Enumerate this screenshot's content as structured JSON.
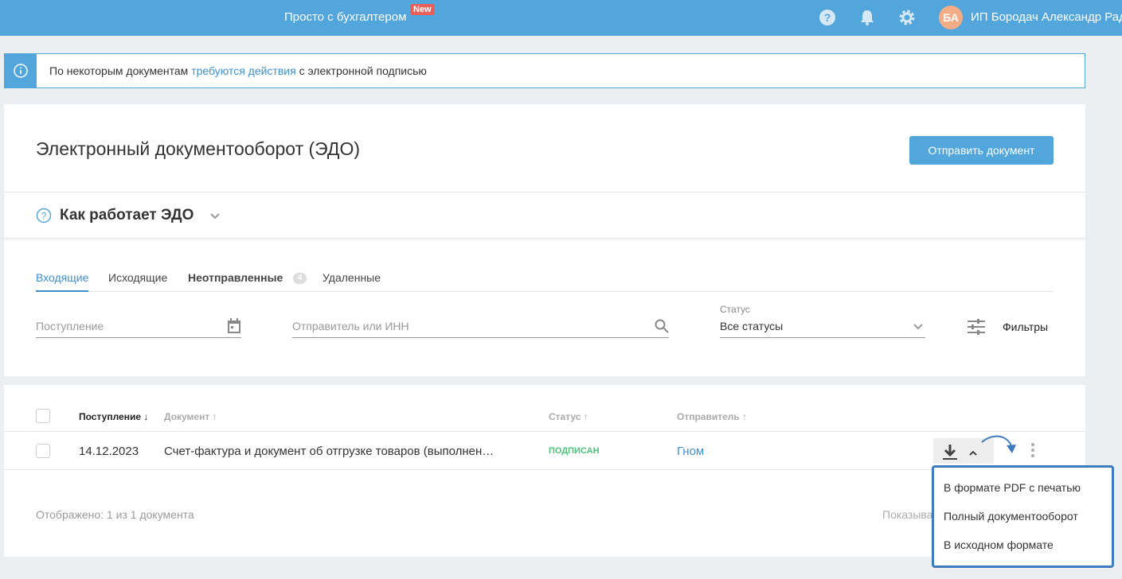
{
  "topbar": {
    "brand": "Просто с бухгалтером",
    "new_badge": "New",
    "avatar_initials": "БА",
    "user_name": "ИП Бородач Александр Радикович",
    "icons": [
      "help-icon",
      "bell-icon",
      "gear-icon"
    ]
  },
  "notice": {
    "prefix": "По некоторым документам ",
    "link": "требуются действия",
    "suffix": " с электронной подписью"
  },
  "page": {
    "title": "Электронный документооборот (ЭДО)",
    "send_button": "Отправить документ",
    "how_it_works": "Как работает ЭДО"
  },
  "tabs": [
    {
      "label": "Входящие",
      "active": true
    },
    {
      "label": "Исходящие"
    },
    {
      "label": "Неотправленные",
      "count": "4"
    },
    {
      "label": "Удаленные"
    }
  ],
  "filters": {
    "date_placeholder": "Поступление",
    "sender_placeholder": "Отправитель или ИНН",
    "status_label": "Статус",
    "status_value": "Все статусы",
    "filters_button": "Фильтры"
  },
  "table": {
    "headers": [
      "Поступление ↓",
      "Документ ↑",
      "Статус ↑",
      "Отправитель ↑"
    ],
    "rows": [
      {
        "date": "14.12.2023",
        "document": "Счет-фактура и документ об отгрузке товаров (выполнен…",
        "status": "ПОДПИСАН",
        "sender": "Гном"
      }
    ],
    "footer": "Отображено: 1 из 1 документа",
    "page_size_label": "Показывать"
  },
  "download_menu": [
    "В формате PDF с печатью",
    "Полный документооборот",
    "В исходном формате"
  ],
  "colors": {
    "accent": "#53a6dc",
    "signed": "#4cc27a",
    "new_badge": "#e8605a"
  }
}
